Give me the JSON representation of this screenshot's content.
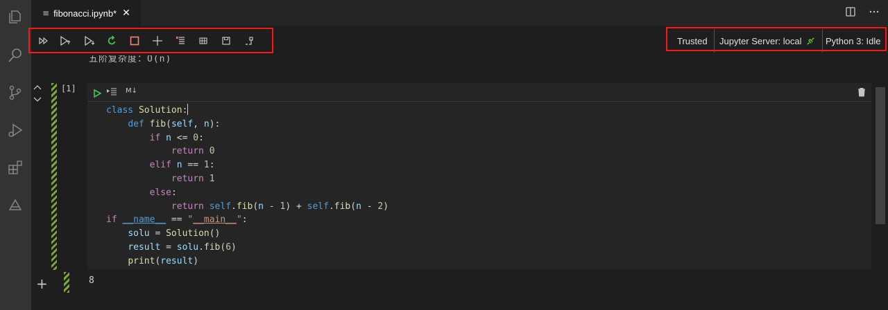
{
  "tab": {
    "title": "fibonacci.ipynb*",
    "close_glyph": "✕",
    "file_glyph": "≡"
  },
  "status": {
    "trusted": "Trusted",
    "server": "Jupyter Server: local",
    "kernel": "Python 3: Idle"
  },
  "partial_text": "五阶复杂度：O(n)",
  "cell": {
    "prompt": "[1]",
    "markdown_toggle": "M↓",
    "code_lines": [
      "class Solution:",
      "    def fib(self, n):",
      "        if n <= 0:",
      "            return 0",
      "        elif n == 1:",
      "            return 1",
      "        else:",
      "            return self.fib(n - 1) + self.fib(n - 2)",
      "if __name__ == \"__main__\":",
      "    solu = Solution()",
      "    result = solu.fib(6)",
      "    print(result)"
    ]
  },
  "output": {
    "text": "8"
  },
  "colors": {
    "highlight_box": "#ff1616",
    "run_green": "#3ec95a",
    "stripe": "#7ba83a"
  }
}
